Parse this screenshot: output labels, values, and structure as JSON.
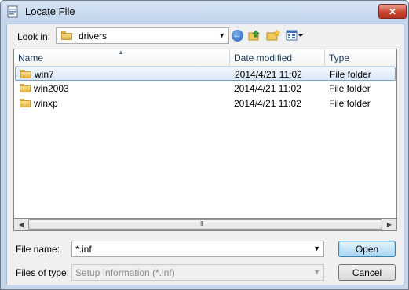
{
  "window": {
    "title": "Locate File",
    "close_glyph": "✕"
  },
  "toolbar": {
    "lookin_label": "Look in:",
    "lookin_value": "drivers",
    "lookin_icon": "folder-icon",
    "back_glyph": "←",
    "icons": [
      "back-icon",
      "up-folder-icon",
      "new-folder-icon",
      "view-menu-icon"
    ]
  },
  "file_list": {
    "columns": [
      {
        "label": "Name"
      },
      {
        "label": "Date modified"
      },
      {
        "label": "Type"
      }
    ],
    "sort_glyph": "▲",
    "rows": [
      {
        "name": "win7",
        "date": "2014/4/21 11:02",
        "type": "File folder",
        "selected": true
      },
      {
        "name": "win2003",
        "date": "2014/4/21 11:02",
        "type": "File folder",
        "selected": false
      },
      {
        "name": "winxp",
        "date": "2014/4/21 11:02",
        "type": "File folder",
        "selected": false
      }
    ]
  },
  "hscroll": {
    "left_glyph": "◀",
    "right_glyph": "▶",
    "grip_glyph": "III"
  },
  "form": {
    "filename_label": "File name:",
    "filename_value": "*.inf",
    "filetype_label": "Files of type:",
    "filetype_value": "Setup Information (*.inf)",
    "dropdown_glyph": "▼"
  },
  "buttons": {
    "open": "Open",
    "cancel": "Cancel"
  },
  "colors": {
    "accent": "#3c7fb1",
    "selection": "#dae8f8",
    "close": "#c9452f"
  }
}
